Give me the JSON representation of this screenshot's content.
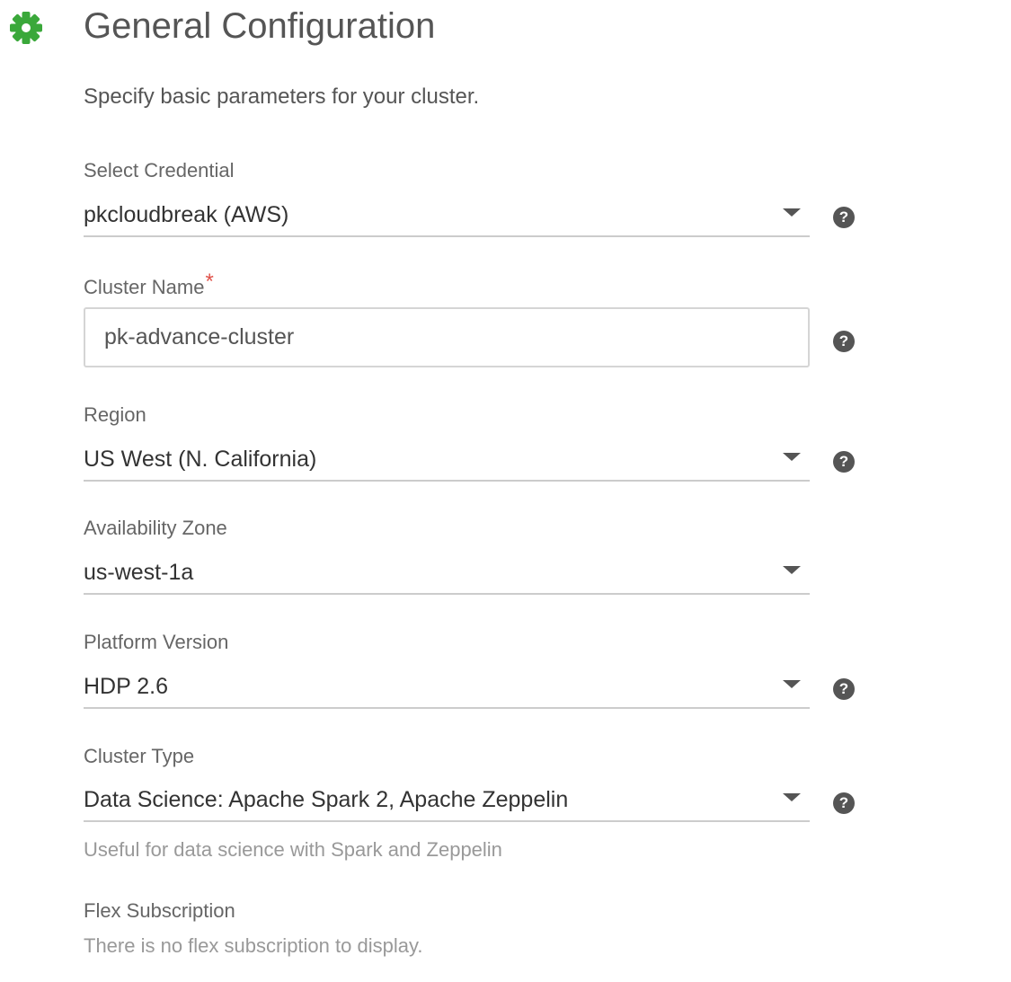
{
  "header": {
    "icon": "gear-icon",
    "icon_color": "#3aa83a",
    "title": "General Configuration",
    "subtitle": "Specify basic parameters for your cluster."
  },
  "fields": {
    "credential": {
      "label": "Select Credential",
      "value": "pkcloudbreak (AWS)",
      "help_icon": "question-circle-icon"
    },
    "cluster_name": {
      "label": "Cluster Name",
      "required_marker": "*",
      "value": "pk-advance-cluster",
      "help_icon": "question-circle-icon"
    },
    "region": {
      "label": "Region",
      "value": "US West (N. California)",
      "help_icon": "question-circle-icon"
    },
    "availability_zone": {
      "label": "Availability Zone",
      "value": "us-west-1a"
    },
    "platform_version": {
      "label": "Platform Version",
      "value": "HDP 2.6",
      "help_icon": "question-circle-icon"
    },
    "cluster_type": {
      "label": "Cluster Type",
      "value": "Data Science: Apache Spark 2, Apache Zeppelin",
      "description": "Useful for data science with Spark and Zeppelin",
      "help_icon": "question-circle-icon"
    },
    "flex_subscription": {
      "label": "Flex Subscription",
      "empty_text": "There is no flex subscription to display."
    }
  },
  "help_glyph": "?",
  "colors": {
    "accent_green": "#3aa83a",
    "required_red": "#e0524a",
    "help_icon": "#555555"
  }
}
